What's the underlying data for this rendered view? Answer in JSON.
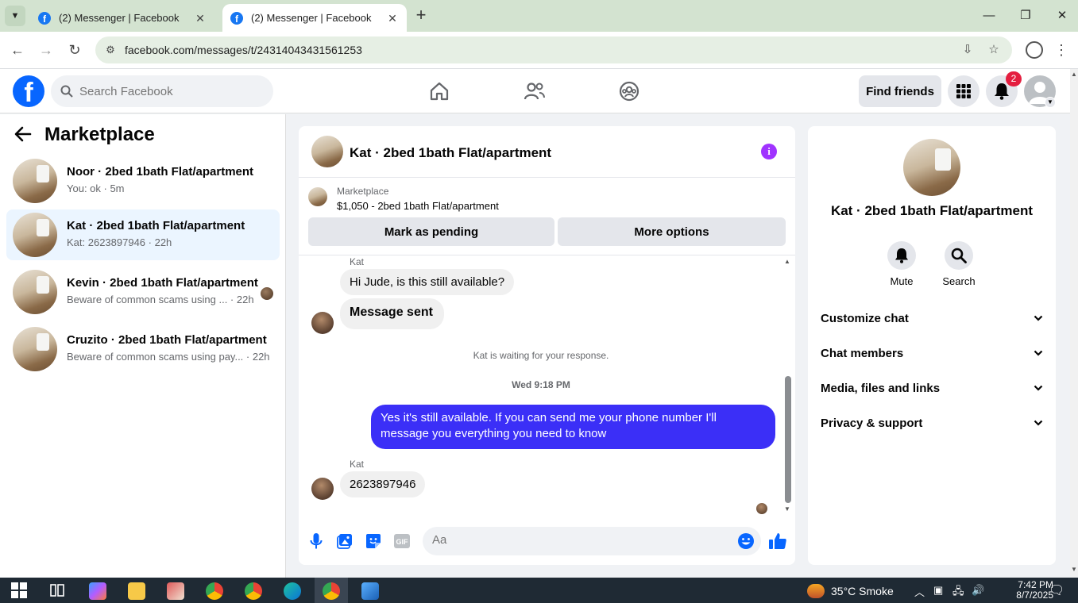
{
  "browser": {
    "tabs": [
      {
        "title": "(2) Messenger | Facebook",
        "active": false
      },
      {
        "title": "(2) Messenger | Facebook",
        "active": true
      }
    ],
    "url": "facebook.com/messages/t/24314043431561253"
  },
  "fb": {
    "search_placeholder": "Search Facebook",
    "find_friends": "Find friends",
    "notification_count": "2"
  },
  "sidebar": {
    "title": "Marketplace",
    "conversations": [
      {
        "name": "Noor · 2bed 1bath Flat/apartment",
        "preview": "You: ok · 5m"
      },
      {
        "name": "Kat · 2bed 1bath Flat/apartment",
        "preview": "Kat: 2623897946 · 22h"
      },
      {
        "name": "Kevin · 2bed 1bath Flat/apartment",
        "preview": "Beware of common scams using ... · 22h"
      },
      {
        "name": "Cruzito · 2bed 1bath Flat/apartment",
        "preview": "Beware of common scams using pay... · 22h"
      }
    ]
  },
  "chat": {
    "title": "Kat · 2bed 1bath Flat/apartment",
    "marketplace_label": "Marketplace",
    "listing": "$1,050 - 2bed 1bath Flat/apartment",
    "mark_pending": "Mark as pending",
    "more_options": "More options",
    "messages": [
      {
        "sender": "Kat",
        "text": "Hi Jude, is this still available?"
      },
      {
        "text": "Message sent"
      },
      {
        "text": "Yes it's still available. If you can send me your phone number I'll message you everything you need to know"
      },
      {
        "sender": "Kat",
        "text": "2623897946"
      }
    ],
    "waiting_note": "Kat is waiting for your response.",
    "date_separator": "Wed 9:18 PM",
    "composer_placeholder": "Aa"
  },
  "info": {
    "title": "Kat · 2bed 1bath Flat/apartment",
    "mute": "Mute",
    "search": "Search",
    "sections": [
      "Customize chat",
      "Chat members",
      "Media, files and links",
      "Privacy & support"
    ]
  },
  "taskbar": {
    "weather": "35°C  Smoke",
    "time": "7:42 PM",
    "date": "8/7/2025"
  },
  "colors": {
    "fb_blue": "#0866ff",
    "outgoing_bubble": "#3b2ff7",
    "selected_row": "#ebf5ff",
    "info_purple": "#a033ff"
  }
}
